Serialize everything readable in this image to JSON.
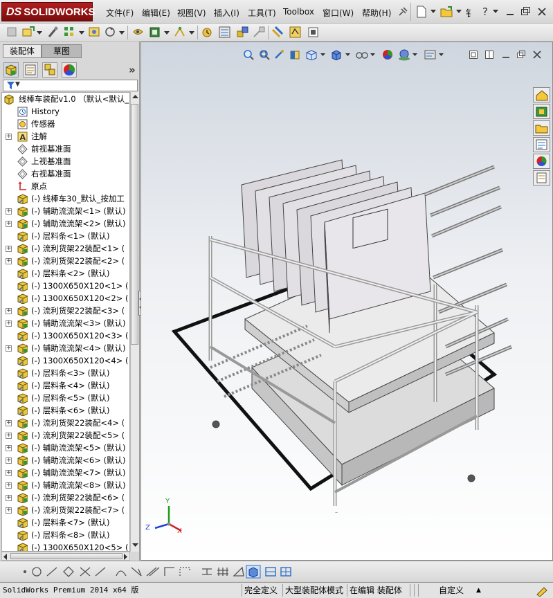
{
  "app": {
    "logo_prefix": "DS",
    "logo_text": "SOLIDWORKS"
  },
  "menu": {
    "items": [
      "文件(F)",
      "编辑(E)",
      "视图(V)",
      "插入(I)",
      "工具(T)",
      "Toolbox",
      "窗口(W)",
      "帮助(H)"
    ],
    "extra_glyph": "钅"
  },
  "panel": {
    "tabs": [
      "装配体",
      "草图"
    ],
    "expand_glyph": "»",
    "filter_glyph": "▼"
  },
  "tree": {
    "root": "线棒车装配v1.0 （默认<默认_",
    "items": [
      {
        "label": "History",
        "expand": false,
        "type": "history"
      },
      {
        "label": "传感器",
        "expand": false,
        "type": "sensor"
      },
      {
        "label": "注解",
        "expand": true,
        "type": "annotation"
      },
      {
        "label": "前视基准面",
        "expand": false,
        "type": "plane"
      },
      {
        "label": "上视基准面",
        "expand": false,
        "type": "plane"
      },
      {
        "label": "右视基准面",
        "expand": false,
        "type": "plane"
      },
      {
        "label": "原点",
        "expand": false,
        "type": "origin"
      },
      {
        "label": "(-) 线棒车30_默认_按加工",
        "expand": false,
        "type": "part"
      },
      {
        "label": "(-) 辅助流流架<1> (默认)",
        "expand": true,
        "type": "asm"
      },
      {
        "label": "(-) 辅助流流架<2> (默认)",
        "expand": true,
        "type": "asm"
      },
      {
        "label": "(-) 层料条<1> (默认)",
        "expand": false,
        "type": "part"
      },
      {
        "label": "(-) 流利货架22装配<1> (",
        "expand": true,
        "type": "asm"
      },
      {
        "label": "(-) 流利货架22装配<2> (",
        "expand": true,
        "type": "asm"
      },
      {
        "label": "(-) 层料条<2> (默认)",
        "expand": false,
        "type": "part"
      },
      {
        "label": "(-) 1300X650X120<1> (",
        "expand": false,
        "type": "part"
      },
      {
        "label": "(-) 1300X650X120<2> (",
        "expand": false,
        "type": "part"
      },
      {
        "label": "(-) 流利货架22装配<3> (",
        "expand": true,
        "type": "asm"
      },
      {
        "label": "(-) 辅助流流架<3> (默认)",
        "expand": true,
        "type": "asm"
      },
      {
        "label": "(-) 1300X650X120<3> (",
        "expand": false,
        "type": "part"
      },
      {
        "label": "(-) 辅助流流架<4> (默认)",
        "expand": true,
        "type": "asm"
      },
      {
        "label": "(-) 1300X650X120<4> (",
        "expand": false,
        "type": "part"
      },
      {
        "label": "(-) 层料条<3> (默认)",
        "expand": false,
        "type": "part"
      },
      {
        "label": "(-) 层料条<4> (默认)",
        "expand": false,
        "type": "part"
      },
      {
        "label": "(-) 层料条<5> (默认)",
        "expand": false,
        "type": "part"
      },
      {
        "label": "(-) 层料条<6> (默认)",
        "expand": false,
        "type": "part"
      },
      {
        "label": "(-) 流利货架22装配<4> (",
        "expand": true,
        "type": "asm"
      },
      {
        "label": "(-) 流利货架22装配<5> (",
        "expand": true,
        "type": "asm"
      },
      {
        "label": "(-) 辅助流流架<5> (默认)",
        "expand": true,
        "type": "asm"
      },
      {
        "label": "(-) 辅助流流架<6> (默认)",
        "expand": true,
        "type": "asm"
      },
      {
        "label": "(-) 辅助流流架<7> (默认)",
        "expand": true,
        "type": "asm"
      },
      {
        "label": "(-) 辅助流流架<8> (默认)",
        "expand": true,
        "type": "asm"
      },
      {
        "label": "(-) 流利货架22装配<6> (",
        "expand": true,
        "type": "asm"
      },
      {
        "label": "(-) 流利货架22装配<7> (",
        "expand": true,
        "type": "asm"
      },
      {
        "label": "(-) 层料条<7> (默认)",
        "expand": false,
        "type": "part"
      },
      {
        "label": "(-) 层料条<8> (默认)",
        "expand": false,
        "type": "part"
      },
      {
        "label": "(-) 1300X650X120<5> (",
        "expand": false,
        "type": "part"
      }
    ]
  },
  "triad": {
    "x": "X",
    "y": "Y",
    "z": "Z"
  },
  "status": {
    "version": "SolidWorks Premium 2014 x64 版",
    "state": "完全定义",
    "mode": "大型装配体模式",
    "editing": "在编辑 装配体",
    "units": "自定义",
    "units_arrow": "▲"
  },
  "colors": {
    "logo": "#9b1414",
    "accent": "#2a6ec8",
    "triad_x": "#d02020",
    "triad_y": "#1a9a1a",
    "triad_z": "#2040d0"
  }
}
